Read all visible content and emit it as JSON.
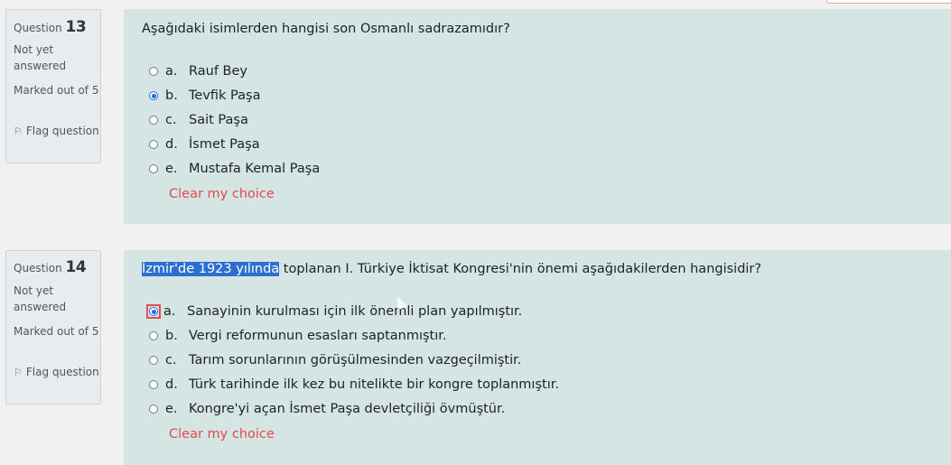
{
  "questions": [
    {
      "label": "Question",
      "number": "13",
      "status": "Not yet answered",
      "marked": "Marked out of 5",
      "flag": "Flag question",
      "text_highlight": "",
      "text_rest": "Aşağıdaki isimlerden hangisi son Osmanlı sadrazamıdır?",
      "options": [
        {
          "letter": "a.",
          "text": "Rauf Bey",
          "checked": false
        },
        {
          "letter": "b.",
          "text": "Tevfik Paşa",
          "checked": true
        },
        {
          "letter": "c.",
          "text": "Sait Paşa",
          "checked": false
        },
        {
          "letter": "d.",
          "text": "İsmet Paşa",
          "checked": false
        },
        {
          "letter": "e.",
          "text": "Mustafa Kemal Paşa",
          "checked": false
        }
      ],
      "clear": "Clear my choice"
    },
    {
      "label": "Question",
      "number": "14",
      "status": "Not yet answered",
      "marked": "Marked out of 5",
      "flag": "Flag question",
      "text_highlight": "İzmir'de 1923 yılında",
      "text_rest": " toplanan I. Türkiye İktisat Kongresi'nin önemi aşağıdakilerden hangisidir?",
      "options": [
        {
          "letter": "a.",
          "text": "Sanayinin kurulması için ilk önemli plan yapılmıştır.",
          "checked": true
        },
        {
          "letter": "b.",
          "text": "Vergi reformunun esasları saptanmıştır.",
          "checked": false
        },
        {
          "letter": "c.",
          "text": "Tarım sorunlarının görüşülmesinden vazgeçilmiştir.",
          "checked": false
        },
        {
          "letter": "d.",
          "text": "Türk tarihinde ilk kez bu nitelikte bir kongre toplanmıştır.",
          "checked": false
        },
        {
          "letter": "e.",
          "text": "Kongre'yi açan İsmet Paşa devletçiliği övmüştür.",
          "checked": false
        }
      ],
      "clear": "Clear my choice"
    }
  ],
  "colors": {
    "content_bg": "#d5e5e4",
    "info_bg": "#e9ecef",
    "clear_link": "#e24b4b",
    "radio_checked": "#1a6ff0",
    "highlight": "#2d6fd1"
  }
}
